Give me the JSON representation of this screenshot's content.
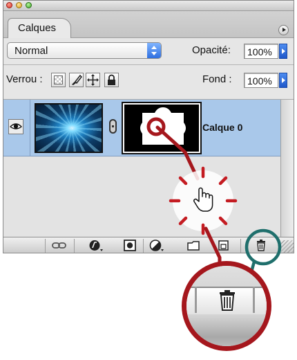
{
  "window": {
    "controls": [
      "close",
      "minimize",
      "zoom"
    ]
  },
  "panel": {
    "tab_label": "Calques",
    "menu_icon": "panel-menu-arrow-icon"
  },
  "blend": {
    "mode": "Normal",
    "opacity_label": "Opacité:",
    "opacity_value": "100%"
  },
  "lock": {
    "label": "Verrou :",
    "icons": [
      "lock-transparency-icon",
      "lock-image-icon",
      "lock-position-icon",
      "lock-all-icon"
    ],
    "fill_label": "Fond :",
    "fill_value": "100%"
  },
  "layers": [
    {
      "name": "Calque 0",
      "visible": true,
      "has_mask": true,
      "selected": true
    }
  ],
  "toolbar": {
    "icons": [
      "link-layers-icon",
      "layer-style-icon",
      "layer-mask-icon",
      "adjustment-layer-icon",
      "new-group-icon",
      "new-layer-icon",
      "trash-icon"
    ]
  },
  "annotations": {
    "arrow_color": "#a5171d",
    "highlight_ring_color": "#1f6f6c",
    "cursor_icon": "hand-pointer-icon",
    "zoom_icon": "trash-icon"
  },
  "colors": {
    "selection": "#a9c8ea",
    "panel": "#dcdcdc",
    "accent_blue": "#2f6fe0"
  }
}
